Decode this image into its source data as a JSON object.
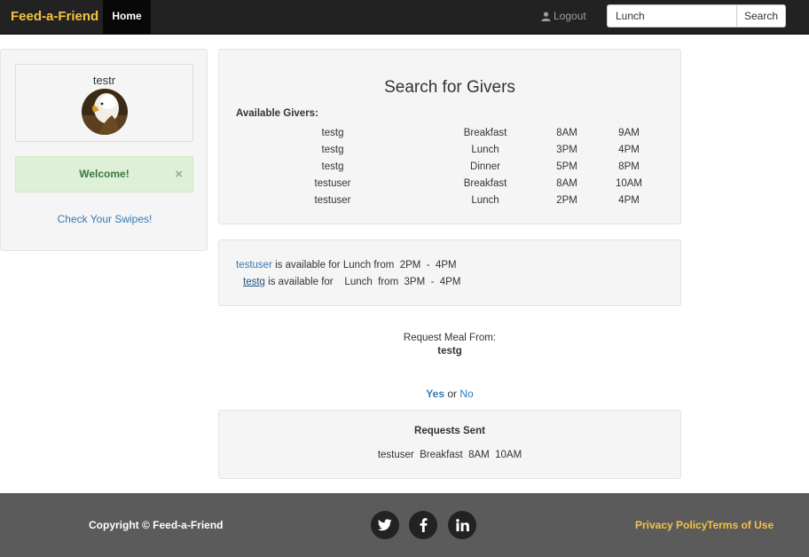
{
  "navbar": {
    "brand": "Feed-a-Friend",
    "home_label": "Home",
    "logout_label": "Logout",
    "search_value": "Lunch",
    "search_button": "Search"
  },
  "profile": {
    "username": "testr",
    "welcome": "Welcome!",
    "close": "×",
    "swipes_link": "Check Your Swipes!"
  },
  "givers": {
    "title": "Search for Givers",
    "label": "Available Givers:",
    "rows": [
      {
        "name": "testg",
        "meal": "Breakfast",
        "start": "8AM",
        "end": "9AM"
      },
      {
        "name": "testg",
        "meal": "Lunch",
        "start": "3PM",
        "end": "4PM"
      },
      {
        "name": "testg",
        "meal": "Dinner",
        "start": "5PM",
        "end": "8PM"
      },
      {
        "name": "testuser",
        "meal": "Breakfast",
        "start": "8AM",
        "end": "10AM"
      },
      {
        "name": "testuser",
        "meal": "Lunch",
        "start": "2PM",
        "end": "4PM"
      }
    ]
  },
  "availability": [
    {
      "name": "testuser",
      "text": " is available for Lunch from  2PM  -  4PM"
    },
    {
      "name": "testg",
      "text": " is available for    Lunch  from  3PM  -  4PM"
    }
  ],
  "request": {
    "label": "Request Meal From:",
    "name": "testg",
    "yes": "Yes",
    "or": " or ",
    "no": "No"
  },
  "requests_sent": {
    "title": "Requests Sent",
    "row": "testuser  Breakfast  8AM  10AM"
  },
  "footer": {
    "copyright": "Copyright © Feed-a-Friend",
    "privacy": "Privacy Policy",
    "terms": "Terms of Use"
  },
  "icons": {
    "user": "user-icon",
    "twitter": "twitter-icon",
    "facebook": "facebook-icon",
    "linkedin": "linkedin-icon"
  },
  "colors": {
    "brand": "#f5c342",
    "navbar": "#222222",
    "link": "#337ab7",
    "success_bg": "#dff0d8",
    "footer_bg": "#5b5b5b"
  }
}
